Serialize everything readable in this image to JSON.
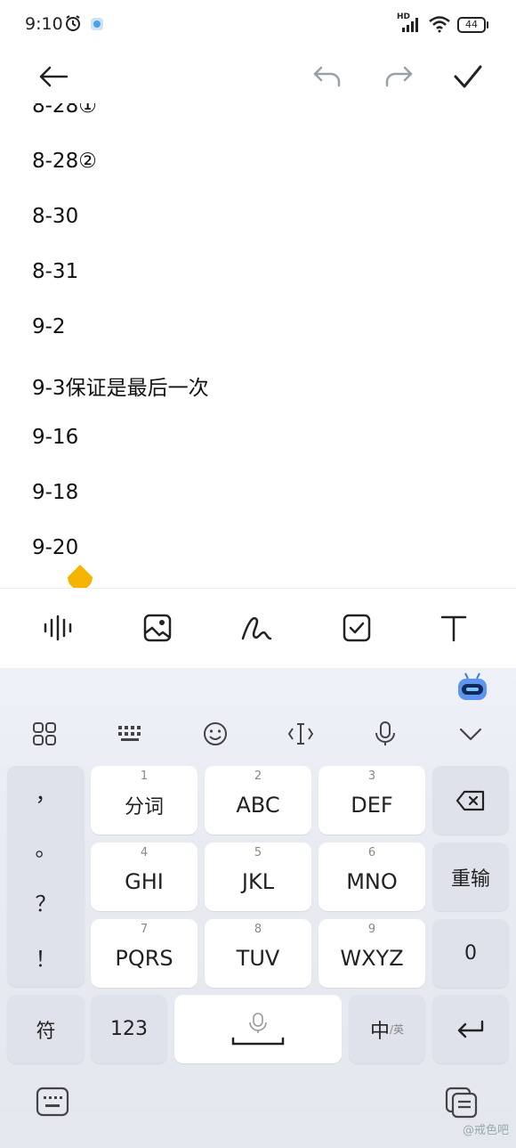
{
  "status_bar": {
    "time": "9:10",
    "network": "HD",
    "battery": "44"
  },
  "note": {
    "partial_top_line": "8-28①",
    "lines": [
      "8-28②",
      "8-30",
      "8-31",
      "9-2",
      "9-3保证是最后一次",
      "9-16",
      "9-18",
      "9-20"
    ]
  },
  "keyboard": {
    "punct_keys": [
      "，",
      "。",
      "？",
      "！"
    ],
    "row1": [
      {
        "num": "1",
        "label": "分词"
      },
      {
        "num": "2",
        "label": "ABC"
      },
      {
        "num": "3",
        "label": "DEF"
      }
    ],
    "row2": [
      {
        "num": "4",
        "label": "GHI"
      },
      {
        "num": "5",
        "label": "JKL"
      },
      {
        "num": "6",
        "label": "MNO"
      }
    ],
    "row3": [
      {
        "num": "7",
        "label": "PQRS"
      },
      {
        "num": "8",
        "label": "TUV"
      },
      {
        "num": "9",
        "label": "WXYZ"
      }
    ],
    "reenter_label": "重输",
    "zero_label": "0",
    "symbol_label": "符",
    "num_label": "123",
    "lang_label": "中",
    "lang_sub": "/英"
  },
  "watermark": "@戒色吧",
  "colors": {
    "accent": "#F5B400",
    "keyboard_bg": "#E8EBF2"
  }
}
